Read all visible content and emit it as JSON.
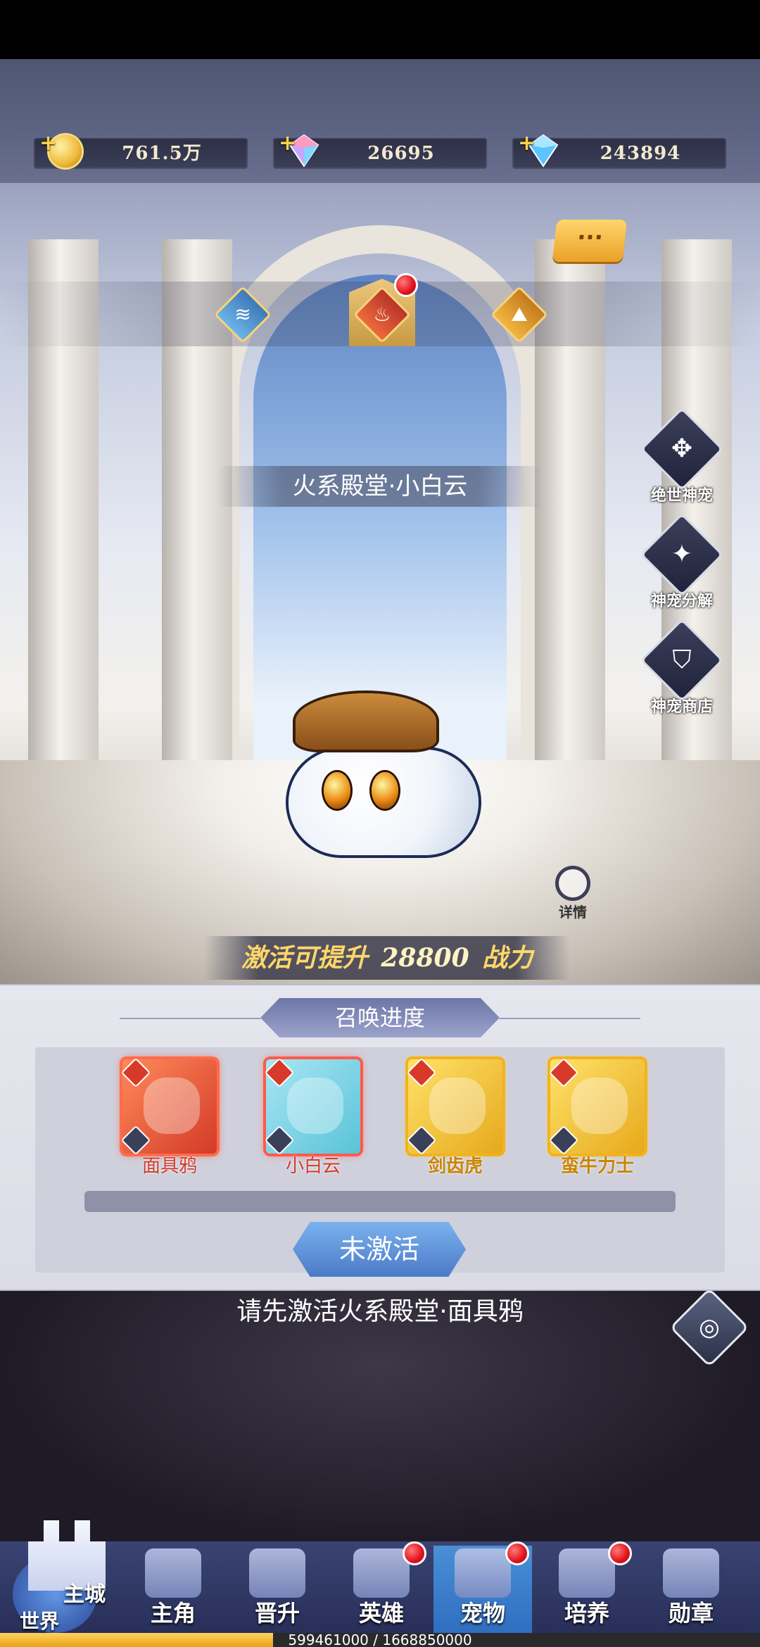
{
  "resources": [
    {
      "icon": "gold-coin-icon",
      "value": "761.5万"
    },
    {
      "icon": "rainbow-gem-icon",
      "value": "26695"
    },
    {
      "icon": "blue-diamond-icon",
      "value": "243894"
    }
  ],
  "chat_button": {
    "icon": "chat-bubble-icon",
    "label": "···"
  },
  "element_tabs": {
    "water": {
      "icon": "water-element-icon",
      "glyph": "≋"
    },
    "fire": {
      "icon": "fire-element-icon",
      "glyph": "♨"
    },
    "earth": {
      "icon": "earth-element-icon",
      "glyph": "⛰"
    }
  },
  "pet_title": "火系殿堂·小白云",
  "side_buttons": [
    {
      "icon": "paw-cards-icon",
      "glyph": "✥",
      "label": "绝世神宠"
    },
    {
      "icon": "sparkle-icon",
      "glyph": "✦",
      "label": "神宠分解"
    },
    {
      "icon": "shop-bag-icon",
      "glyph": "⛉",
      "label": "神宠商店"
    }
  ],
  "detail_label": "详情",
  "power": {
    "prefix": "激活可提升",
    "value": "28800",
    "suffix": "战力"
  },
  "summon": {
    "title": "召唤进度",
    "cards": [
      {
        "name": "面具鸦",
        "frame": "red"
      },
      {
        "name": "小白云",
        "frame": "blue"
      },
      {
        "name": "剑齿虎",
        "frame": "gold"
      },
      {
        "name": "蛮牛力士",
        "frame": "gold"
      }
    ],
    "activate_label": "未激活"
  },
  "hint": "请先激活火系殿堂·面具鸦",
  "nav": {
    "home": {
      "top": "主城",
      "bottom": "世界"
    },
    "items": [
      "主角",
      "晋升",
      "英雄",
      "宠物",
      "培养",
      "勋章"
    ]
  },
  "exp": {
    "text": "599461000 / 1668850000",
    "fraction": 0.359
  }
}
